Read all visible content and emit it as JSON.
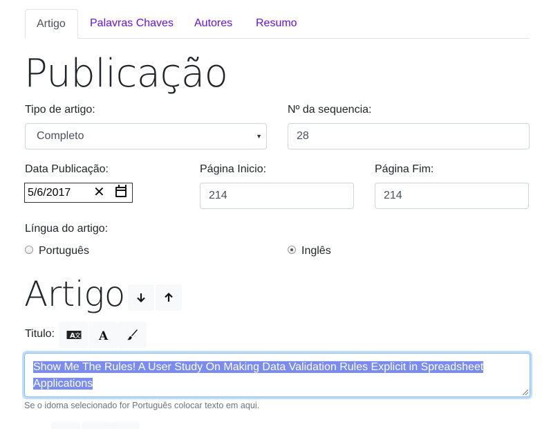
{
  "tabs": [
    {
      "label": "Artigo",
      "active": true
    },
    {
      "label": "Palavras Chaves",
      "active": false
    },
    {
      "label": "Autores",
      "active": false
    },
    {
      "label": "Resumo",
      "active": false
    }
  ],
  "page_title": "Publicação",
  "form": {
    "tipo_label": "Tipo de artigo:",
    "tipo_value": "Completo",
    "sequencia_label": "Nº da sequencia:",
    "sequencia_value": "28",
    "data_label": "Data Publicação:",
    "data_value": "5/6/2017",
    "pagina_inicio_label": "Página Inicio:",
    "pagina_inicio_value": "214",
    "pagina_fim_label": "Página Fim:",
    "pagina_fim_value": "214",
    "lingua_label": "Língua do artigo:",
    "lingua_options": [
      {
        "label": "Português",
        "checked": false
      },
      {
        "label": "Inglês",
        "checked": true
      }
    ]
  },
  "artigo": {
    "title": "Artigo",
    "move_down_icon": "arrow-down-icon",
    "move_up_icon": "arrow-up-icon",
    "titulo_label": "Titulo:",
    "toolbar_icons": [
      "translate-icon",
      "font-icon",
      "brush-icon"
    ],
    "titulo_value": "Show Me The Rules! A User Study On Making Data Validation Rules Explicit in Spreadsheet Applications",
    "help_text": "Se o idoma selecionado for Português colocar texto em aqui."
  },
  "colors": {
    "tab_link": "#6610f2",
    "selection": "#7b8cf0",
    "focus_border": "#80bdff"
  }
}
